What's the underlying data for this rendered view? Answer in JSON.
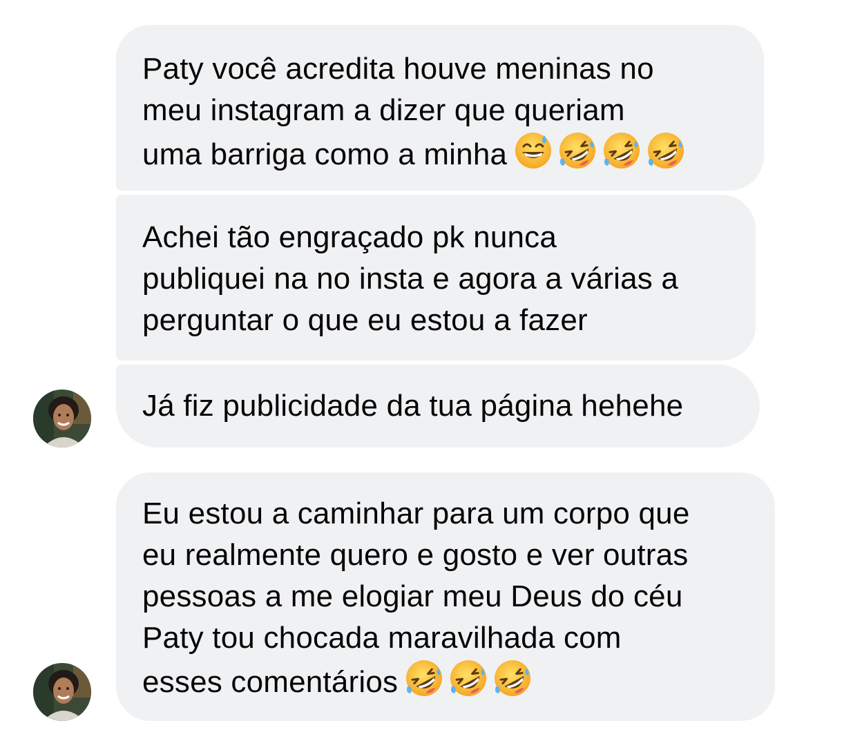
{
  "messages": [
    {
      "text": "Paty você acredita houve meninas no\nmeu instagram a dizer que queriam\numa barriga como a minha",
      "emojis": [
        "grinning-sweat-emoji",
        "rofl-emoji",
        "rofl-emoji",
        "rofl-emoji"
      ]
    },
    {
      "text": "Achei tão engraçado pk nunca\npubliquei na no insta e agora a várias a\nperguntar o que eu estou a fazer",
      "emojis": []
    },
    {
      "text": "Já fiz publicidade da tua página hehehe",
      "emojis": []
    },
    {
      "text": "Eu estou a caminhar para um corpo que\neu realmente quero e gosto e ver outras\npessoas a me elogiar meu Deus do céu\nPaty tou chocada maravilhada com\nesses comentários",
      "emojis": [
        "rofl-emoji",
        "rofl-emoji",
        "rofl-emoji"
      ]
    }
  ],
  "colors": {
    "bubble": "#f0f1f3",
    "text": "#050505",
    "background": "#ffffff"
  }
}
